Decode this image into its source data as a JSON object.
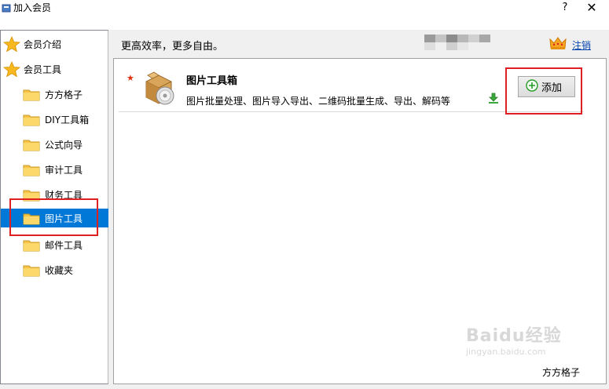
{
  "window": {
    "title": "加入会员",
    "help_label": "?",
    "close_label": "✕"
  },
  "sidebar": {
    "items": [
      {
        "label": "会员介绍",
        "icon": "star-icon",
        "level": 0
      },
      {
        "label": "会员工具",
        "icon": "star-icon",
        "level": 0
      },
      {
        "label": "方方格子",
        "icon": "folder-icon",
        "level": 1
      },
      {
        "label": "DIY工具箱",
        "icon": "folder-icon",
        "level": 1
      },
      {
        "label": "公式向导",
        "icon": "folder-icon",
        "level": 1
      },
      {
        "label": "审计工具",
        "icon": "folder-icon",
        "level": 1
      },
      {
        "label": "财务工具",
        "icon": "folder-icon",
        "level": 1
      },
      {
        "label": "图片工具",
        "icon": "folder-icon",
        "level": 1,
        "selected": true
      },
      {
        "label": "邮件工具",
        "icon": "folder-icon",
        "level": 1
      },
      {
        "label": "收藏夹",
        "icon": "folder-icon",
        "level": 1
      }
    ]
  },
  "header": {
    "slogan": "更高效率，更多自由。",
    "logout_label": "注销"
  },
  "tool": {
    "name": "图片工具箱",
    "description": "图片批量处理、图片导入导出、二维码批量生成、导出、解码等",
    "add_label": "添加"
  },
  "footer": {
    "corner_text": "方方格子",
    "watermark_main": "Baidu经验",
    "watermark_sub": "jingyan.baidu.com"
  },
  "colors": {
    "selection": "#0078d7",
    "annotation_red": "#e02020",
    "link": "#0645ad",
    "folder": "#f7c44a"
  }
}
